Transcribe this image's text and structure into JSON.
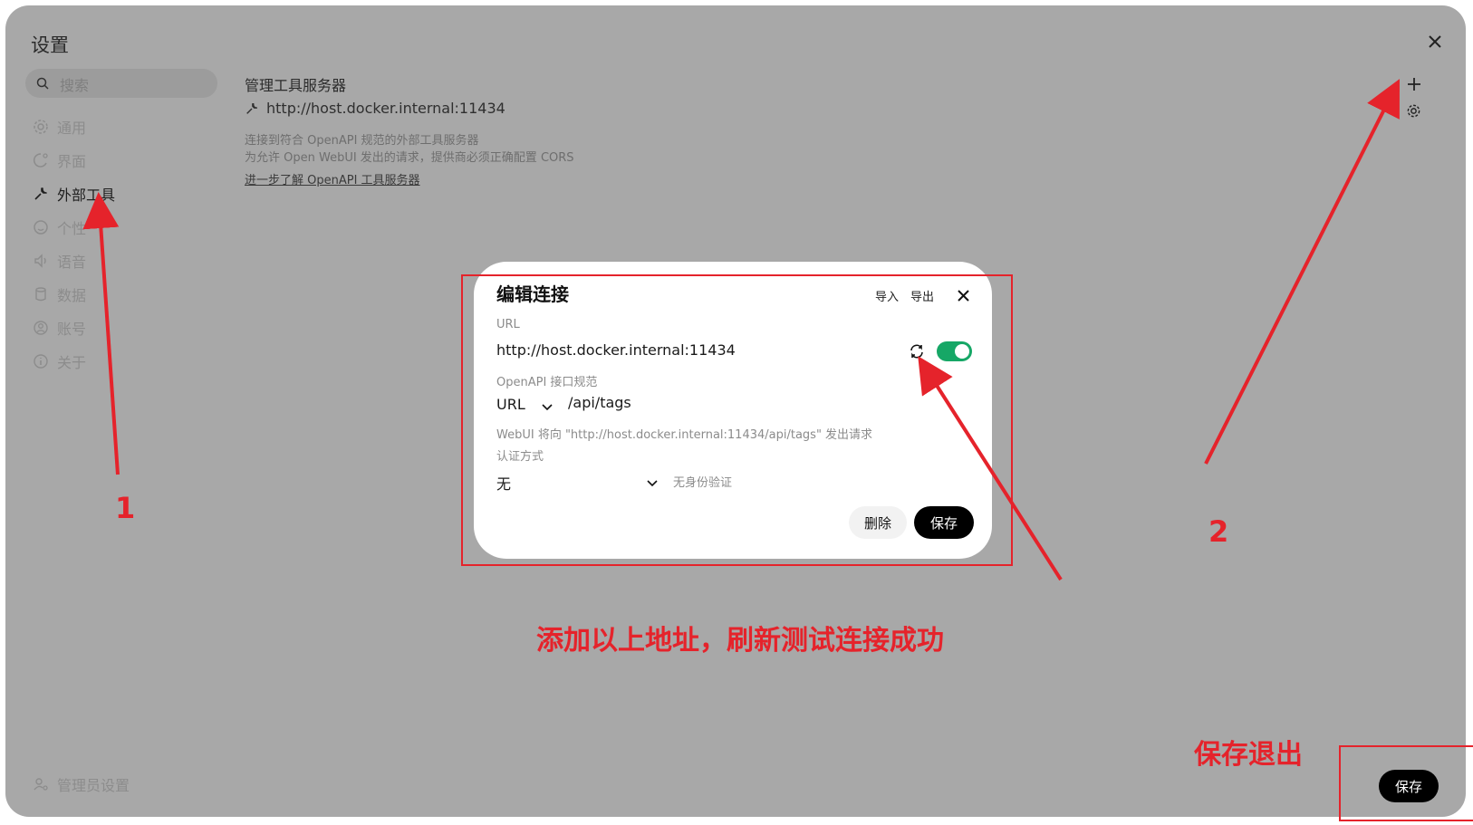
{
  "window": {
    "title": "设置"
  },
  "search": {
    "placeholder": "搜索"
  },
  "sidebar": {
    "items": [
      {
        "label": "通用",
        "icon": "gear-icon"
      },
      {
        "label": "界面",
        "icon": "palette-icon"
      },
      {
        "label": "外部工具",
        "icon": "wrench-icon",
        "active": true
      },
      {
        "label": "个性",
        "icon": "smile-icon"
      },
      {
        "label": "语音",
        "icon": "speaker-icon"
      },
      {
        "label": "数据",
        "icon": "database-icon"
      },
      {
        "label": "账号",
        "icon": "user-circle-icon"
      },
      {
        "label": "关于",
        "icon": "info-icon"
      }
    ],
    "admin_label": "管理员设置"
  },
  "main": {
    "section_title": "管理工具服务器",
    "server_url": "http://host.docker.internal:11434",
    "desc_line1": "连接到符合 OpenAPI 规范的外部工具服务器",
    "desc_line2": "为允许 Open WebUI 发出的请求，提供商必须正确配置 CORS",
    "learn_more": "进一步了解 OpenAPI 工具服务器",
    "save_label": "保存"
  },
  "modal": {
    "title": "编辑连接",
    "import_label": "导入",
    "export_label": "导出",
    "url_label": "URL",
    "url_value": "http://host.docker.internal:11434",
    "enabled": true,
    "spec_label": "OpenAPI 接口规范",
    "spec_type": "URL",
    "spec_path": "/api/tags",
    "request_hint": "WebUI 将向 \"http://host.docker.internal:11434/api/tags\" 发出请求",
    "auth_label": "认证方式",
    "auth_value": "无",
    "auth_note": "无身份验证",
    "delete_label": "删除",
    "save_label": "保存"
  },
  "annotations": {
    "num1": "1",
    "num2": "2",
    "caption": "添加以上地址，刷新测试连接成功",
    "save_exit": "保存退出",
    "color": "#e5232b"
  },
  "colors": {
    "overlay_bg": "#a8a8a8",
    "toggle_on": "#16a766",
    "button_dark": "#000000"
  }
}
